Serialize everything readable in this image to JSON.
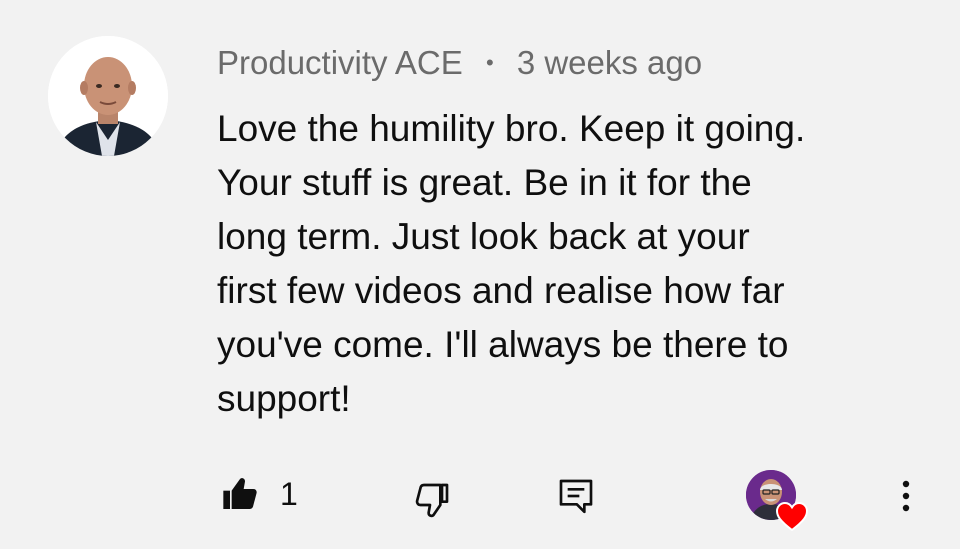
{
  "comment": {
    "author": "Productivity ACE",
    "separator": "•",
    "timestamp": "3 weeks ago",
    "text": "Love the humility bro. Keep it going.\nYour stuff is great. Be in it for the\nlong term. Just look back at your\nfirst few videos and realise how far\nyou've come. I'll always be there to\nsupport!",
    "avatar_icon": "user-avatar"
  },
  "actions": {
    "like_icon": "thumbs-up-filled-icon",
    "like_count": "1",
    "dislike_icon": "thumbs-down-outline-icon",
    "reply_icon": "reply-comment-icon",
    "creator_heart_icon": "creator-heart-icon",
    "more_icon": "more-vertical-icon"
  },
  "colors": {
    "background": "#f2f2f2",
    "text_primary": "#0f0f0f",
    "text_secondary": "#6b6b6b",
    "heart": "#ff0000",
    "creator_avatar_bg": "#6a2a8c"
  }
}
